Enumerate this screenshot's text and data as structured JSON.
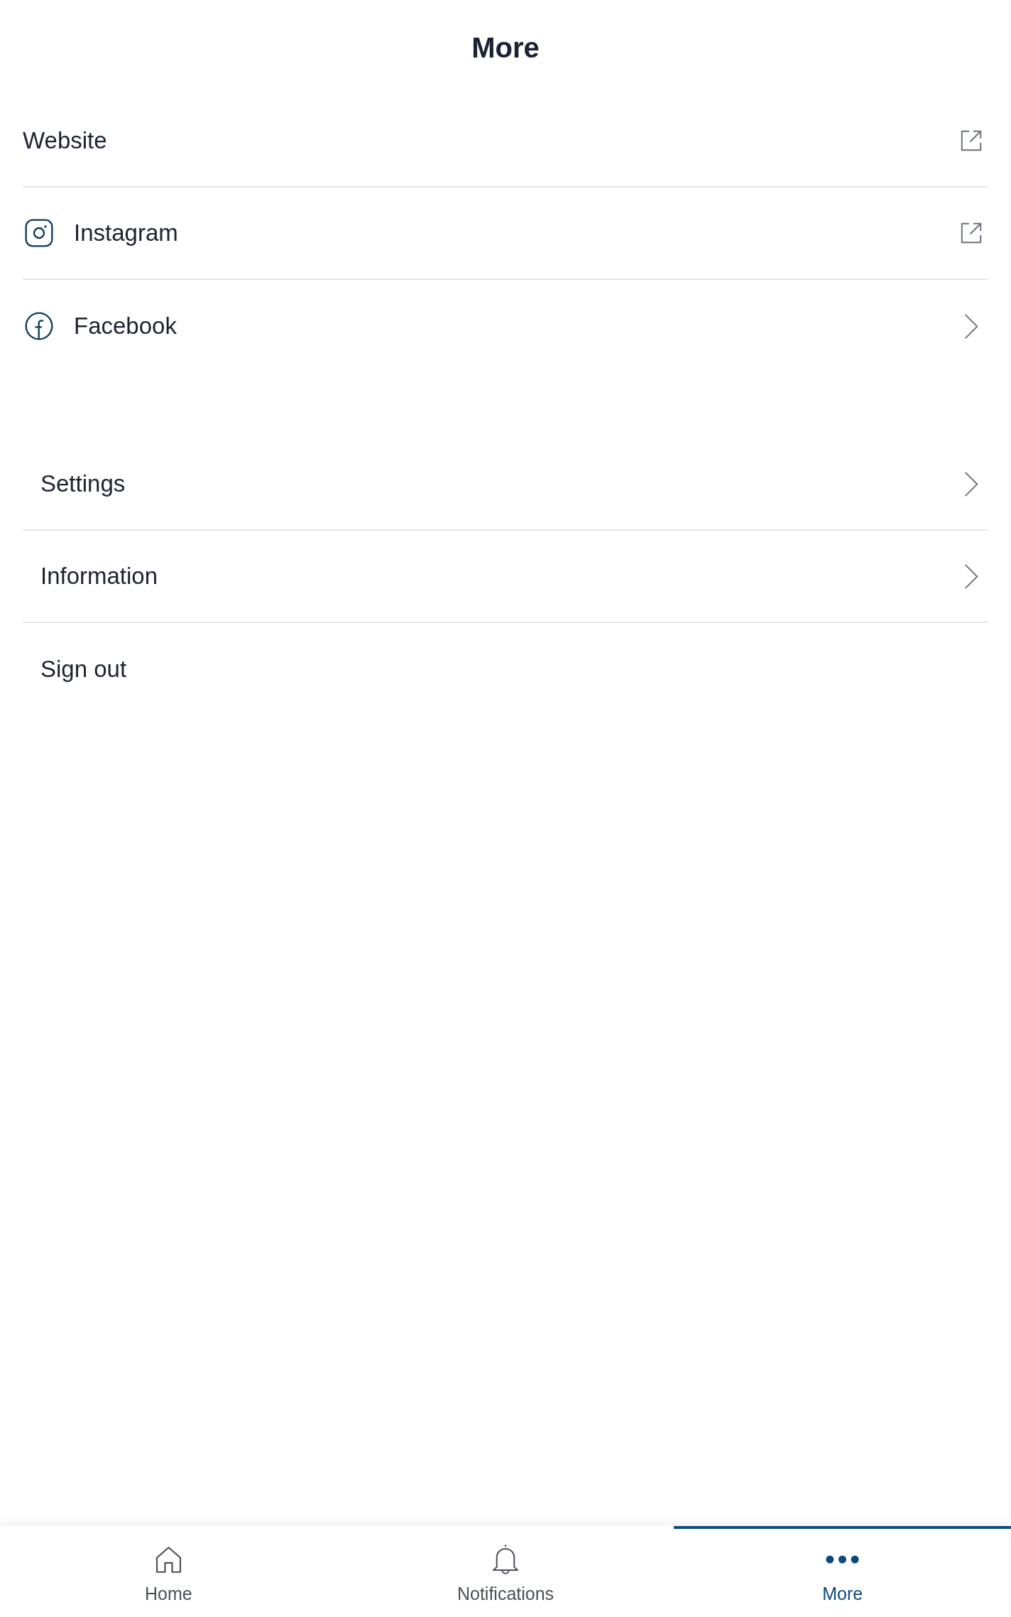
{
  "header": {
    "title": "More"
  },
  "sections": [
    {
      "items": [
        {
          "label": "Website",
          "kind": "website"
        },
        {
          "label": "Instagram",
          "kind": "instagram"
        },
        {
          "label": "Facebook",
          "kind": "facebook"
        }
      ]
    },
    {
      "items": [
        {
          "label": "Settings",
          "kind": "page"
        },
        {
          "label": "Information",
          "kind": "page"
        },
        {
          "label": "Sign out",
          "kind": "action"
        }
      ]
    }
  ],
  "tab_bar": {
    "tabs": [
      {
        "label": "Home",
        "kind": "home",
        "selected": false
      },
      {
        "label": "Notifications",
        "kind": "notifications",
        "selected": false
      },
      {
        "label": "More",
        "kind": "more",
        "selected": true
      }
    ]
  }
}
